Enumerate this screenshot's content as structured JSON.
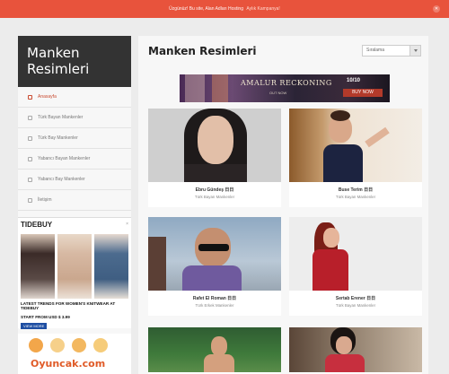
{
  "notice": {
    "text": "Üzgünüz! Bu site, Alan Adları Hosting",
    "link": "Aylık Kampanya!",
    "close": "✕"
  },
  "site": {
    "title": "Manken Resimleri"
  },
  "menu": {
    "items": [
      {
        "label": "Anasayfa",
        "icon": "home-icon",
        "active": true
      },
      {
        "label": "Türk Bayan Mankenler",
        "icon": "folder-icon",
        "active": false
      },
      {
        "label": "Türk Bay Mankenler",
        "icon": "folder-icon",
        "active": false
      },
      {
        "label": "Yabancı Bayan Mankenler",
        "icon": "folder-icon",
        "active": false
      },
      {
        "label": "Yabancı Bay Mankenler",
        "icon": "link-icon",
        "active": false
      },
      {
        "label": "İletişim",
        "icon": "mail-icon",
        "active": false
      }
    ]
  },
  "ads": {
    "tidebuy": {
      "title": "TIDEBUY",
      "close": "×",
      "text": "LATEST TRENDS FOR WOMEN'S KNITWEAR AT TIDEBUY",
      "sub": "START FROM USD $ 3.99",
      "button": "VIEW MORE"
    },
    "oyuncak": {
      "logo": "Oyuncak.com"
    }
  },
  "main": {
    "title": "Manken Resimleri",
    "sort": {
      "selected": "Sıralama"
    },
    "banner": {
      "title": "AMALUR RECKONING",
      "sub": "OUT NOW",
      "score": "10/10",
      "button": "BUY NOW"
    }
  },
  "cards": [
    {
      "name": "Ebru Gündeş 日日",
      "category": "Türk Bayan Mankenler"
    },
    {
      "name": "Buse Terim 日日",
      "category": "Türk Bayan Mankenler"
    },
    {
      "name": "Rafet El Roman 日日",
      "category": "Türk Erkek Mankenler"
    },
    {
      "name": "Sertab Erener 日日",
      "category": "Türk Bayan Mankenler"
    },
    {
      "name": "",
      "category": ""
    },
    {
      "name": "",
      "category": ""
    }
  ],
  "colors": {
    "accent": "#e8533c",
    "logo_bg": "#333333",
    "active_menu": "#c94b31",
    "page_bg": "#ececec"
  }
}
